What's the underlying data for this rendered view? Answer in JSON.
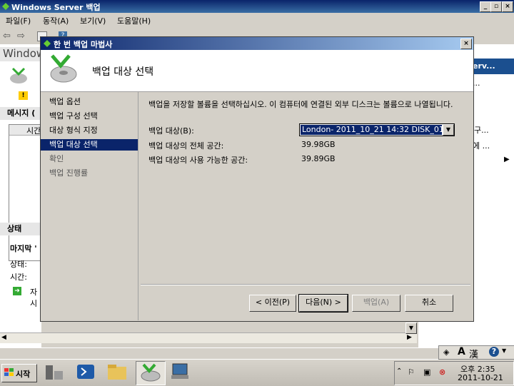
{
  "main_window": {
    "title": "Windows Server 백업"
  },
  "menu": [
    "파일(F)",
    "동작(A)",
    "보기(V)",
    "도움말(H)"
  ],
  "background": {
    "left_title": "Windows",
    "warning_glyph": "!",
    "messages_label": "메시지 (",
    "time_column": "시간",
    "status_title": "상태",
    "last_label": "마지막 '",
    "state_label": "상태:",
    "time_label": "시간:",
    "item_text": "자시",
    "right_header": "erv...",
    "right_ellipsis_1": "...",
    "right_item_2": "구...",
    "right_item_3": "에 ..."
  },
  "wizard": {
    "title": "한 번 백업 마법사",
    "header": "백업 대상 선택",
    "nav": [
      "백업 옵션",
      "백업 구성 선택",
      "대상 형식 지정",
      "백업 대상 선택",
      "확인",
      "백업 진행률"
    ],
    "selected_nav_index": 3,
    "instruction": "백업을 저장할 볼륨을 선택하십시오. 이 컴퓨터에 연결된 외부 디스크는 볼륨으로 나열됩니다.",
    "target_label": "백업 대상(B):",
    "target_value": "London- 2011_10_21 14:32 DISK_01 (E:)",
    "total_label": "백업 대상의 전체 공간:",
    "total_value": "39.98GB",
    "free_label": "백업 대상의 사용 가능한 공간:",
    "free_value": "39.89GB",
    "buttons": {
      "prev": "< 이전(P)",
      "next": "다음(N) >",
      "backup": "백업(A)",
      "cancel": "취소"
    }
  },
  "taskbar": {
    "start": "시작",
    "ime_a": "A",
    "ime_han": "漢",
    "help": "?",
    "clock_time": "오후 2:35",
    "clock_date": "2011-10-21"
  }
}
